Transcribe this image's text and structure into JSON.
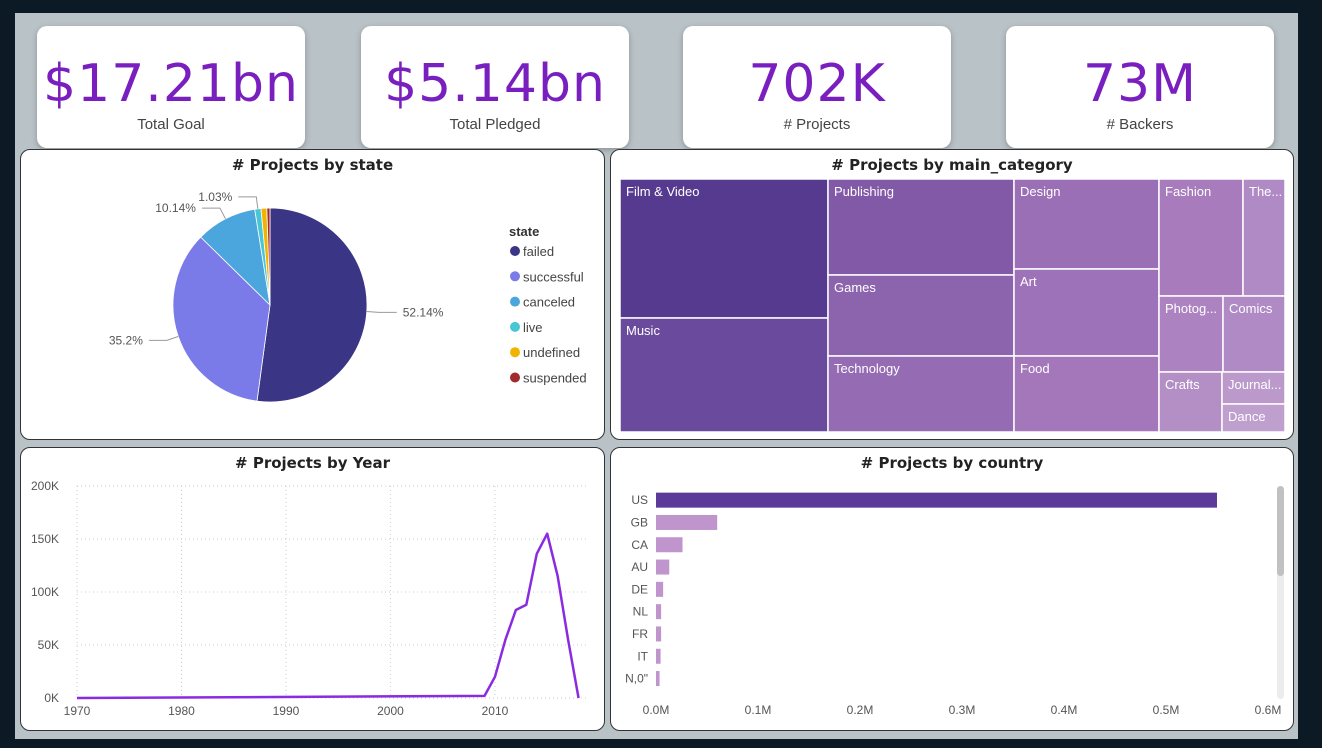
{
  "colors": {
    "accent": "#7a1fbf"
  },
  "kpis": [
    {
      "value": "$17.21bn",
      "label": "Total Goal"
    },
    {
      "value": "$5.14bn",
      "label": "Total Pledged"
    },
    {
      "value": "702K",
      "label": "# Projects"
    },
    {
      "value": "73M",
      "label": "# Backers"
    }
  ],
  "pie": {
    "title": "# Projects by state",
    "legend_title": "state",
    "chart_data": {
      "type": "pie",
      "labels": [
        "failed",
        "successful",
        "canceled",
        "live",
        "undefined",
        "suspended"
      ],
      "values": [
        52.14,
        35.2,
        10.14,
        1.03,
        0.97,
        0.52
      ],
      "colors": [
        "#3b3586",
        "#7a7be8",
        "#4aa6dc",
        "#49c6d6",
        "#f0b400",
        "#a12b2b"
      ],
      "data_labels": [
        "52.14%",
        "35.2%",
        "10.14%",
        "1.03%",
        "",
        ""
      ]
    }
  },
  "treemap": {
    "title": "# Projects by main_category",
    "chart_data": {
      "type": "treemap",
      "labels": [
        "Film & Video",
        "Music",
        "Publishing",
        "Games",
        "Technology",
        "Design",
        "Art",
        "Food",
        "Fashion",
        "The...",
        "Photog...",
        "Comics",
        "Crafts",
        "Journal...",
        "Dance"
      ]
    }
  },
  "line": {
    "title": "# Projects by Year",
    "chart_data": {
      "type": "line",
      "x": [
        1970,
        2009,
        2010,
        2011,
        2012,
        2013,
        2014,
        2015,
        2016,
        2017,
        2018
      ],
      "y": [
        0,
        2000,
        20000,
        55000,
        83000,
        88000,
        136000,
        155000,
        115000,
        55000,
        0
      ],
      "xticks": [
        "1970",
        "1980",
        "1990",
        "2000",
        "2010"
      ],
      "yticks": [
        "0K",
        "50K",
        "100K",
        "150K",
        "200K"
      ],
      "ylim": [
        0,
        200000
      ],
      "xlim": [
        1970,
        2019
      ]
    }
  },
  "bar": {
    "title": "# Projects by country",
    "chart_data": {
      "type": "bar",
      "categories": [
        "US",
        "GB",
        "CA",
        "AU",
        "DE",
        "NL",
        "FR",
        "IT",
        "N,0\""
      ],
      "values": [
        550000,
        60000,
        26000,
        13000,
        7000,
        5000,
        5000,
        4500,
        3500
      ],
      "xticks": [
        "0.0M",
        "0.1M",
        "0.2M",
        "0.3M",
        "0.4M",
        "0.5M",
        "0.6M"
      ],
      "xlim": [
        0,
        600000
      ],
      "colors": [
        "#5b3a9a",
        "#c094cc"
      ]
    }
  }
}
